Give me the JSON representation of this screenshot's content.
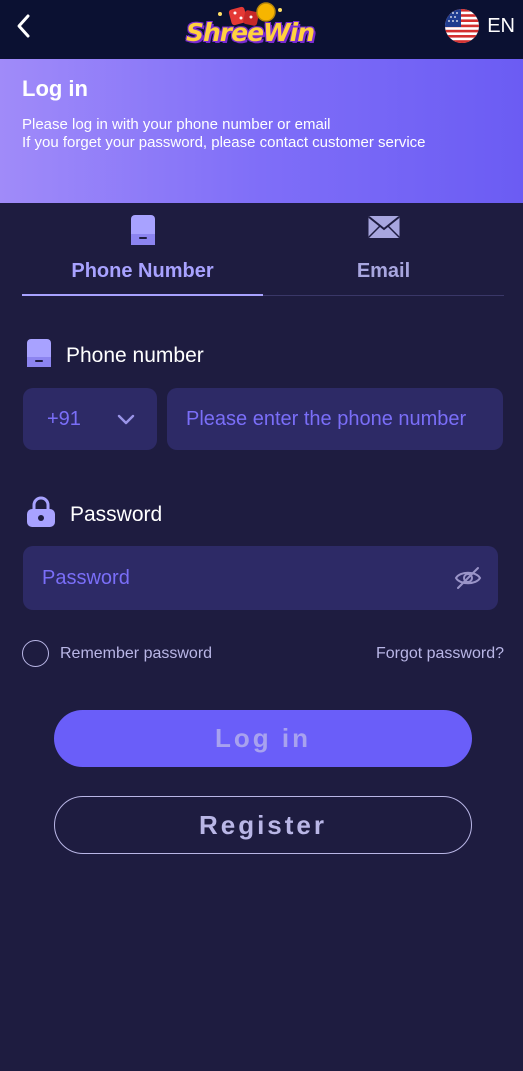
{
  "header": {
    "logo_text": "ShreeWin",
    "language": "EN"
  },
  "hero": {
    "title": "Log in",
    "desc_line1": "Please log in with your phone number or email",
    "desc_line2": "If you forget your password, please contact customer service"
  },
  "tabs": [
    {
      "label": "Phone Number",
      "icon": "phone-icon",
      "active": true
    },
    {
      "label": "Email",
      "icon": "mail-icon",
      "active": false
    }
  ],
  "phone": {
    "label": "Phone number",
    "country_code": "+91",
    "placeholder": "Please enter the phone number"
  },
  "password": {
    "label": "Password",
    "placeholder": "Password"
  },
  "remember_label": "Remember password",
  "forgot_label": "Forgot password?",
  "login_button": "Log in",
  "register_button": "Register",
  "colors": {
    "background": "#1e1c40",
    "topbar": "#0b1132",
    "accent": "#6a5ef9",
    "input_bg": "#2d2a66"
  }
}
